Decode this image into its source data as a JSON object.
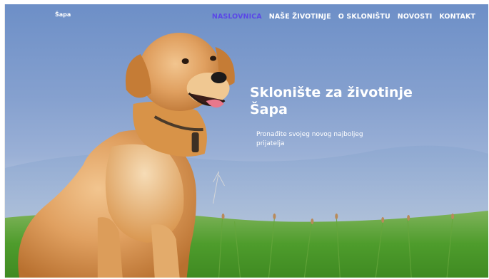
{
  "site": {
    "logo_text": "Šapa"
  },
  "nav": {
    "items": [
      {
        "label": "NASLOVNICA",
        "active": true
      },
      {
        "label": "NAŠE ŽIVOTINJE",
        "active": false
      },
      {
        "label": "O SKLONIŠTU",
        "active": false
      },
      {
        "label": "NOVOSTI",
        "active": false
      },
      {
        "label": "KONTAKT",
        "active": false
      }
    ]
  },
  "hero": {
    "title_line1": "Sklonište za životinje",
    "title_line2": "Šapa",
    "subtitle_line1": "Pronađite svojeg novog najboljeg",
    "subtitle_line2": "prijatelja",
    "image": "golden-retriever-dog-photo"
  },
  "colors": {
    "accent": "#5b49e6",
    "sky": "#86a1cf",
    "grass": "#4d9a2f",
    "dog": "#d9924a"
  }
}
